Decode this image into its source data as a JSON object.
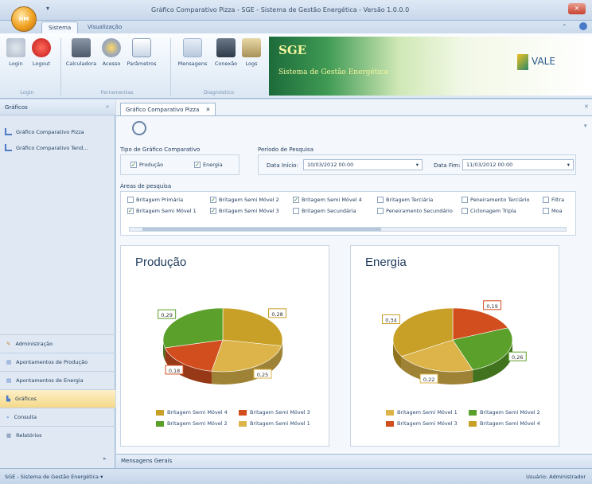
{
  "window": {
    "title": "Gráfico Comparativo Pizza - SGE - Sistema de Gestão Energética - Versão 1.0.0.0",
    "orb_label": "HM"
  },
  "ribbon": {
    "tabs": [
      "Sistema",
      "Visualização"
    ],
    "buttons": [
      {
        "label": "Login",
        "icon": "key-icon"
      },
      {
        "label": "Logout",
        "icon": "power-icon"
      },
      {
        "label": "Calculadora",
        "icon": "calculator-icon"
      },
      {
        "label": "Acesso",
        "icon": "gear-icon"
      },
      {
        "label": "Parâmetros",
        "icon": "document-icon"
      },
      {
        "label": "Mensagens",
        "icon": "message-icon"
      },
      {
        "label": "Conexão",
        "icon": "network-icon"
      },
      {
        "label": "Logs",
        "icon": "database-icon"
      }
    ],
    "groups": [
      "Login",
      "Ferramentas",
      "Diagnóstico"
    ],
    "banner_title": "SGE",
    "banner_subtitle": "Sistema de Gestão Energética",
    "brand": "VALE"
  },
  "sidebar": {
    "header": "Gráficos",
    "items": [
      "Gráfico Comparativo Pizza",
      "Gráfico Comparativo Tend..."
    ],
    "nav": [
      "Administração",
      "Apontamentos de Produção",
      "Apontamentos de Energia",
      "Gráficos",
      "Consulta",
      "Relatórios"
    ]
  },
  "document_tab": "Gráfico Comparativo Pizza",
  "filters": {
    "tipo_title": "Tipo de Gráfico Comparativo",
    "producao": "Produção",
    "energia": "Energia",
    "periodo_title": "Período de Pesquisa",
    "inicio_label": "Data Início:",
    "inicio_value": "10/03/2012 00:00",
    "fim_label": "Data Fim:",
    "fim_value": "11/03/2012 00:00",
    "areas_title": "Áreas de pesquisa",
    "areas_row1": [
      "Britagem Primária",
      "Britagem Semi Móvel 2",
      "Britagem Semi Móvel 4",
      "Britagem Terciária",
      "Peneiramento Terciário",
      "Filtra"
    ],
    "areas_row2": [
      "Britagem Semi Móvel 1",
      "Britagem Semi Móvel 3",
      "Britagem Secundária",
      "Peneiramento Secundário",
      "Ciclonagem Tripla",
      "Moa"
    ],
    "checked_row1": [
      false,
      true,
      true,
      false,
      false,
      false
    ],
    "checked_row2": [
      true,
      true,
      false,
      false,
      false,
      false
    ]
  },
  "chart_data": [
    {
      "type": "pie",
      "title": "Produção",
      "slices": [
        {
          "label": "Britagem Semi Móvel 4",
          "value": 0.28,
          "color": "#c8a028"
        },
        {
          "label": "Britagem Semi Móvel 1",
          "value": 0.25,
          "color": "#dcb44a"
        },
        {
          "label": "Britagem Semi Móvel 3",
          "value": 0.18,
          "color": "#d24e1e"
        },
        {
          "label": "Britagem Semi Móvel 2",
          "value": 0.29,
          "color": "#5aa02a"
        }
      ],
      "legend": [
        "Britagem Semi Móvel 4",
        "Britagem Semi Móvel 3",
        "Britagem Semi Móvel 2",
        "Britagem Semi Móvel 1"
      ]
    },
    {
      "type": "pie",
      "title": "Energia",
      "slices": [
        {
          "label": "Britagem Semi Móvel 3",
          "value": 0.19,
          "color": "#d24e1e"
        },
        {
          "label": "Britagem Semi Móvel 2",
          "value": 0.26,
          "color": "#5aa02a"
        },
        {
          "label": "Britagem Semi Móvel 1",
          "value": 0.22,
          "color": "#dcb44a"
        },
        {
          "label": "Britagem Semi Móvel 4",
          "value": 0.34,
          "color": "#c8a028"
        }
      ],
      "legend": [
        "Britagem Semi Móvel 1",
        "Britagem Semi Móvel 2",
        "Britagem Semi Móvel 3",
        "Britagem Semi Móvel 4"
      ]
    }
  ],
  "messages_tab": "Mensagens Gerais",
  "status": {
    "left": "SGE - Sistema de Gestão Energética ▾",
    "user_label": "Usuário:",
    "user": "Administrador"
  }
}
